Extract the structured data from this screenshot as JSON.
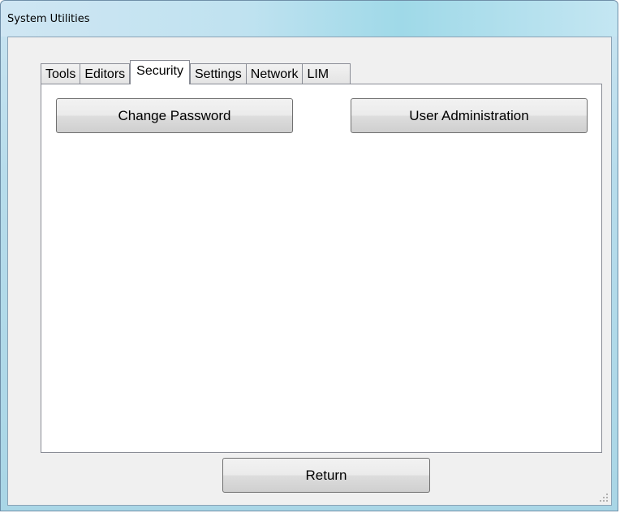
{
  "window": {
    "title": "System Utilities"
  },
  "tabs": [
    {
      "label": "Tools",
      "active": false
    },
    {
      "label": "Editors",
      "active": false
    },
    {
      "label": "Security",
      "active": true
    },
    {
      "label": "Settings",
      "active": false
    },
    {
      "label": "Network",
      "active": false
    },
    {
      "label": "LIM",
      "active": false
    }
  ],
  "security_panel": {
    "change_password_label": "Change Password",
    "user_administration_label": "User Administration"
  },
  "footer": {
    "return_label": "Return"
  },
  "colors": {
    "title_bar": "#bfe2f0",
    "client_background": "#f0f0f0",
    "panel_background": "#ffffff",
    "border": "#898c95"
  },
  "icons": {
    "resize_grip": "resize-grip-icon"
  }
}
